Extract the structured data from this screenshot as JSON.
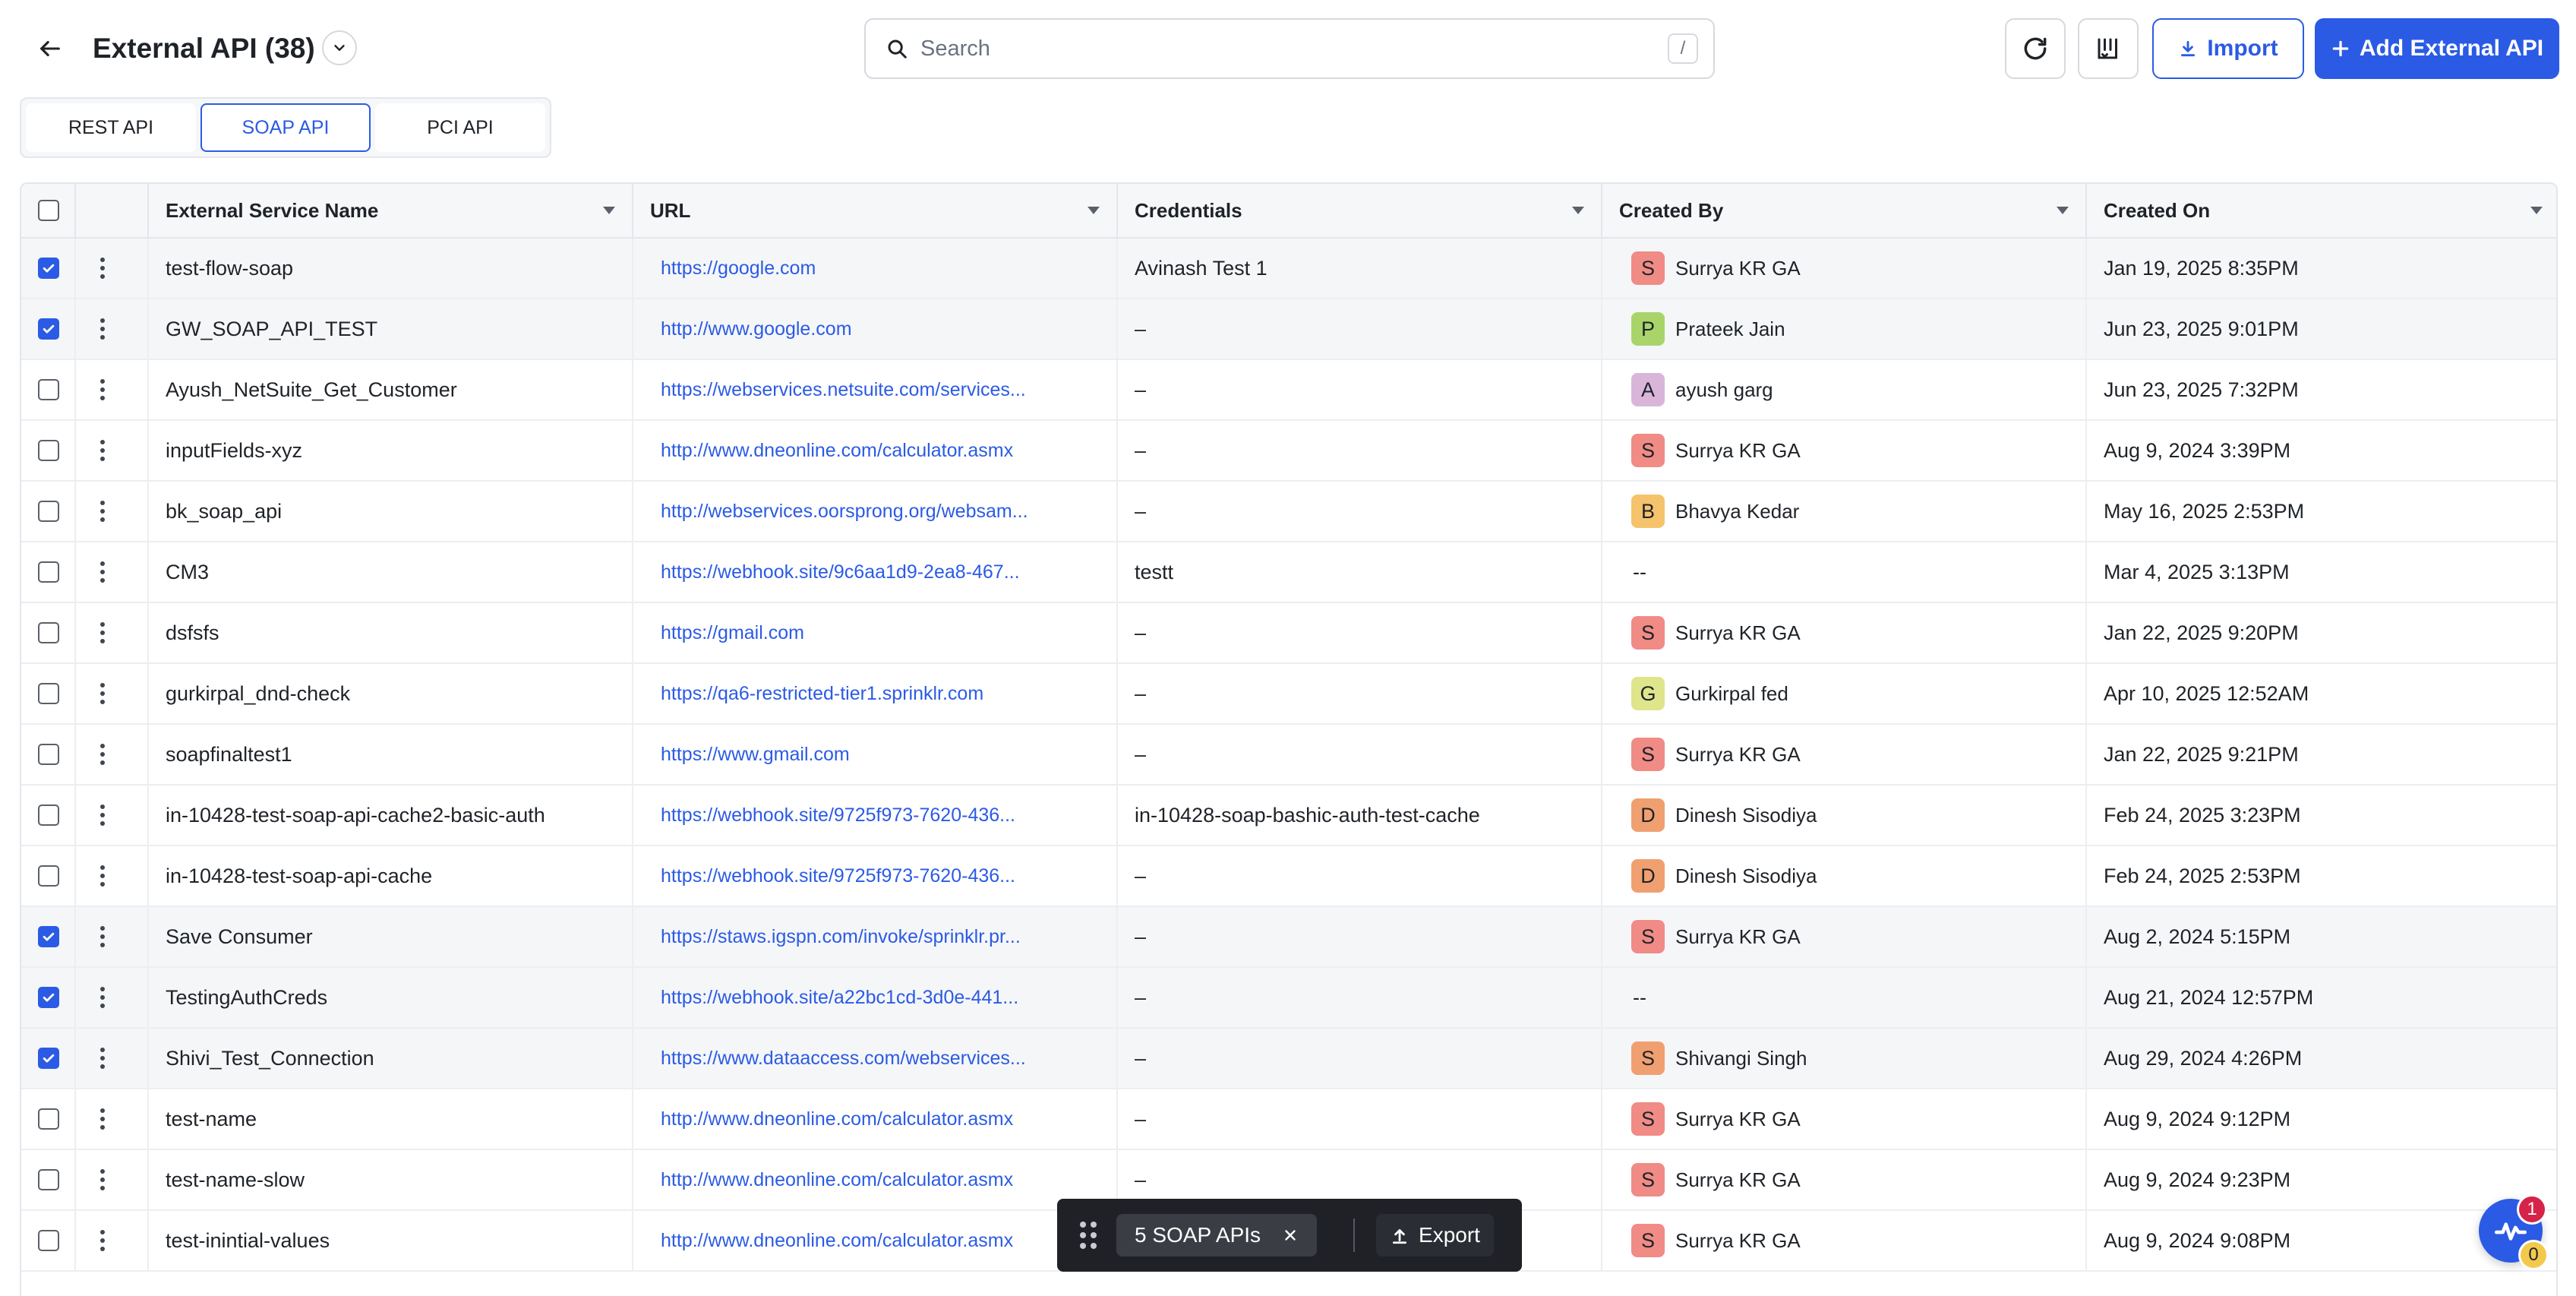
{
  "header": {
    "title": "External API (38)",
    "search_placeholder": "Search",
    "search_shortcut": "/",
    "import_label": "Import",
    "add_label": "Add External API"
  },
  "tabs": [
    {
      "label": "REST API",
      "active": false
    },
    {
      "label": "SOAP API",
      "active": true
    },
    {
      "label": "PCI API",
      "active": false
    }
  ],
  "columns": [
    "External Service Name",
    "URL",
    "Credentials",
    "Created By",
    "Created On"
  ],
  "rows": [
    {
      "checked": true,
      "name": "test-flow-soap",
      "url": "https://google.com",
      "credentials": "Avinash Test 1",
      "initial": "S",
      "creator": "Surrya KR GA",
      "avatar_color": "#f08b86",
      "created_on": "Jan 19, 2025 8:35PM"
    },
    {
      "checked": true,
      "name": "GW_SOAP_API_TEST",
      "url": "http://www.google.com",
      "credentials": "–",
      "initial": "P",
      "creator": "Prateek Jain",
      "avatar_color": "#a9d46a",
      "created_on": "Jun 23, 2025 9:01PM"
    },
    {
      "checked": false,
      "name": "Ayush_NetSuite_Get_Customer",
      "url": "https://webservices.netsuite.com/services...",
      "credentials": "–",
      "initial": "A",
      "creator": "ayush garg",
      "avatar_color": "#d9b6d9",
      "created_on": "Jun 23, 2025 7:32PM"
    },
    {
      "checked": false,
      "name": "inputFields-xyz",
      "url": "http://www.dneonline.com/calculator.asmx",
      "credentials": "–",
      "initial": "S",
      "creator": "Surrya KR GA",
      "avatar_color": "#f08b86",
      "created_on": "Aug 9, 2024 3:39PM"
    },
    {
      "checked": false,
      "name": "bk_soap_api",
      "url": "http://webservices.oorsprong.org/websam...",
      "credentials": "–",
      "initial": "B",
      "creator": "Bhavya Kedar",
      "avatar_color": "#f5c36b",
      "created_on": "May 16, 2025 2:53PM"
    },
    {
      "checked": false,
      "name": "CM3",
      "url": "https://webhook.site/9c6aa1d9-2ea8-467...",
      "credentials": "testt",
      "initial": "",
      "creator": "--",
      "avatar_color": "",
      "created_on": "Mar 4, 2025 3:13PM"
    },
    {
      "checked": false,
      "name": "dsfsfs",
      "url": "https://gmail.com",
      "credentials": "–",
      "initial": "S",
      "creator": "Surrya KR GA",
      "avatar_color": "#f08b86",
      "created_on": "Jan 22, 2025 9:20PM"
    },
    {
      "checked": false,
      "name": "gurkirpal_dnd-check",
      "url": "https://qa6-restricted-tier1.sprinklr.com",
      "credentials": "–",
      "initial": "G",
      "creator": "Gurkirpal fed",
      "avatar_color": "#dfe58a",
      "created_on": "Apr 10, 2025 12:52AM"
    },
    {
      "checked": false,
      "name": "soapfinaltest1",
      "url": "https://www.gmail.com",
      "credentials": "–",
      "initial": "S",
      "creator": "Surrya KR GA",
      "avatar_color": "#f08b86",
      "created_on": "Jan 22, 2025 9:21PM"
    },
    {
      "checked": false,
      "name": "in-10428-test-soap-api-cache2-basic-auth",
      "url": "https://webhook.site/9725f973-7620-436...",
      "credentials": "in-10428-soap-bashic-auth-test-cache",
      "initial": "D",
      "creator": "Dinesh Sisodiya",
      "avatar_color": "#f0a070",
      "created_on": "Feb 24, 2025 3:23PM"
    },
    {
      "checked": false,
      "name": "in-10428-test-soap-api-cache",
      "url": "https://webhook.site/9725f973-7620-436...",
      "credentials": "–",
      "initial": "D",
      "creator": "Dinesh Sisodiya",
      "avatar_color": "#f0a070",
      "created_on": "Feb 24, 2025 2:53PM"
    },
    {
      "checked": true,
      "name": "Save Consumer",
      "url": "https://staws.igspn.com/invoke/sprinklr.pr...",
      "credentials": "–",
      "initial": "S",
      "creator": "Surrya KR GA",
      "avatar_color": "#f08b86",
      "created_on": "Aug 2, 2024 5:15PM"
    },
    {
      "checked": true,
      "name": "TestingAuthCreds",
      "url": "https://webhook.site/a22bc1cd-3d0e-441...",
      "credentials": "–",
      "initial": "",
      "creator": "--",
      "avatar_color": "",
      "created_on": "Aug 21, 2024 12:57PM"
    },
    {
      "checked": true,
      "name": "Shivi_Test_Connection",
      "url": "https://www.dataaccess.com/webservices...",
      "credentials": "–",
      "initial": "S",
      "creator": "Shivangi Singh",
      "avatar_color": "#f0a070",
      "created_on": "Aug 29, 2024 4:26PM"
    },
    {
      "checked": false,
      "name": "test-name",
      "url": "http://www.dneonline.com/calculator.asmx",
      "credentials": "–",
      "initial": "S",
      "creator": "Surrya KR GA",
      "avatar_color": "#f08b86",
      "created_on": "Aug 9, 2024 9:12PM"
    },
    {
      "checked": false,
      "name": "test-name-slow",
      "url": "http://www.dneonline.com/calculator.asmx",
      "credentials": "–",
      "initial": "S",
      "creator": "Surrya KR GA",
      "avatar_color": "#f08b86",
      "created_on": "Aug 9, 2024 9:23PM"
    },
    {
      "checked": false,
      "name": "test-inintial-values",
      "url": "http://www.dneonline.com/calculator.asmx",
      "credentials": "–",
      "initial": "S",
      "creator": "Surrya KR GA",
      "avatar_color": "#f08b86",
      "created_on": "Aug 9, 2024 9:08PM"
    }
  ],
  "bulkbar": {
    "selection_label": "5 SOAP APIs",
    "export_label": "Export"
  },
  "widget": {
    "badge_top": "1",
    "badge_bottom": "0"
  },
  "colors": {
    "accent": "#2b5be5"
  }
}
